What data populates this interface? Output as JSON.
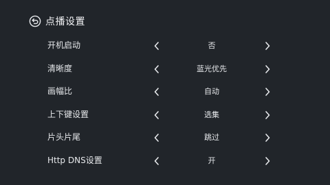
{
  "header": {
    "title": "点播设置",
    "back_icon": "back-arrow-circle-icon"
  },
  "settings": [
    {
      "label": "开机启动",
      "value": "否"
    },
    {
      "label": "清晰度",
      "value": "蓝光优先"
    },
    {
      "label": "画幅比",
      "value": "自动"
    },
    {
      "label": "上下键设置",
      "value": "选集"
    },
    {
      "label": "片头片尾",
      "value": "跳过"
    },
    {
      "label": "Http DNS设置",
      "value": "开"
    }
  ],
  "colors": {
    "background": "#21252a",
    "text": "#e9ebee"
  }
}
